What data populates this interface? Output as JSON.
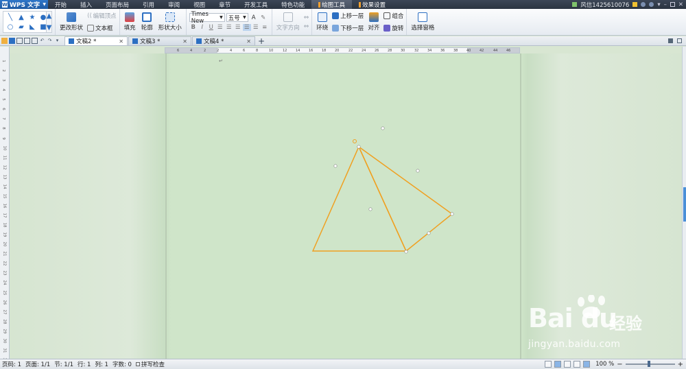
{
  "menubar": {
    "app_name": "WPS 文字",
    "items": [
      "开始",
      "插入",
      "页面布局",
      "引用",
      "审阅",
      "视图",
      "章节",
      "开发工具",
      "特色功能"
    ],
    "context_tabs": [
      "绘图工具",
      "效果设置"
    ],
    "user": "风信1425610076"
  },
  "ribbon": {
    "edit_vertex": "编辑顶点",
    "change_shape": "更改形状",
    "text_box": "文本框",
    "fill": "填充",
    "outline": "轮廓",
    "shape_size": "形状大小",
    "font_name": "Times New",
    "font_size": "五号",
    "bold": "B",
    "italic": "I",
    "underline": "U",
    "text_direction": "文字方向",
    "wrap": "环绕",
    "bring_forward": "上移一层",
    "send_backward": "下移一层",
    "align": "对齐",
    "group": "组合",
    "rotate": "旋转",
    "selection_pane": "选择窗格"
  },
  "tabs": [
    {
      "label": "文稿2 *",
      "active": true
    },
    {
      "label": "文稿3 *",
      "active": false
    },
    {
      "label": "文稿4 *",
      "active": false
    }
  ],
  "ruler": {
    "h_labels": [
      "6",
      "4",
      "2",
      "2",
      "4",
      "6",
      "8",
      "10",
      "12",
      "14",
      "16",
      "18",
      "20",
      "22",
      "24",
      "26",
      "28",
      "30",
      "32",
      "34",
      "36",
      "38",
      "40",
      "42",
      "44",
      "46"
    ],
    "v_labels": [
      "1",
      "2",
      "3",
      "4",
      "5",
      "6",
      "7",
      "8",
      "9",
      "10",
      "11",
      "12",
      "13",
      "14",
      "15",
      "16",
      "17",
      "18",
      "19",
      "20",
      "21",
      "22",
      "23",
      "24",
      "25",
      "26",
      "27",
      "28",
      "29",
      "30",
      "31",
      "32"
    ]
  },
  "statusbar": {
    "page_no": "页码: 1",
    "pages": "页面: 1/1",
    "section": "节: 1/1",
    "line": "行: 1",
    "column": "列: 1",
    "word_count": "字数: 0",
    "spell_check": "拼写检查",
    "zoom": "100 %"
  },
  "watermark": {
    "brand": "Bai du",
    "cn": "经验",
    "url": "jingyan.baidu.com"
  },
  "colors": {
    "shape_outline": "#f0a020",
    "accent": "#2c6fc2"
  }
}
